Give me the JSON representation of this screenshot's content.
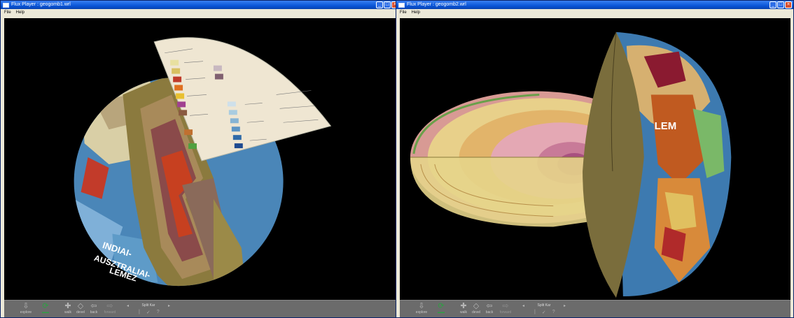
{
  "left_window": {
    "title": "Flux Player : geogomb1.wrl",
    "menu": [
      "File",
      "Help"
    ],
    "toolbar": {
      "tools": [
        {
          "label": "explore",
          "icon": "explore-icon"
        },
        {
          "label": "",
          "icon": "rotate-icon",
          "active": true
        },
        {
          "label": "walk",
          "icon": "walk-icon"
        },
        {
          "label": "devel",
          "icon": "devel-icon"
        },
        {
          "label": "back",
          "icon": "back-icon"
        },
        {
          "label": "forward",
          "icon": "forward-icon",
          "disabled": true
        }
      ],
      "viewpoint": "Split Kar",
      "help": "?"
    }
  },
  "right_window": {
    "title": "Flux Player : geogomb2.wrl",
    "menu": [
      "File",
      "Help"
    ],
    "toolbar": {
      "tools": [
        {
          "label": "explore",
          "icon": "explore-icon"
        },
        {
          "label": "",
          "icon": "rotate-icon",
          "active": true
        },
        {
          "label": "walk",
          "icon": "walk-icon"
        },
        {
          "label": "devel",
          "icon": "devel-icon"
        },
        {
          "label": "back",
          "icon": "back-icon"
        },
        {
          "label": "forward",
          "icon": "forward-icon",
          "disabled": true
        }
      ],
      "viewpoint": "Split Kar",
      "help": "?"
    }
  },
  "scene_labels": {
    "left_globe_text": "INDIAI-\nAUSZTRALIAI-\nLEMEZ",
    "right_globe_text": "LEM"
  },
  "colors": {
    "titlebar": "#0a56d8",
    "toolbar_bg": "#6b6b6b",
    "viewport_bg": "#000000",
    "active_tool": "#2ea043"
  }
}
